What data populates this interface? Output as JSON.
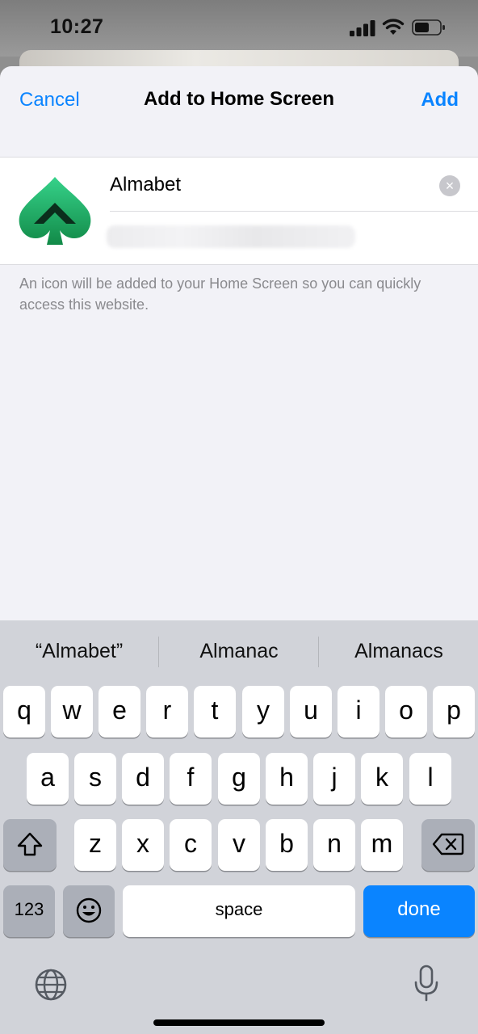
{
  "status_bar": {
    "time": "10:27"
  },
  "sheet": {
    "nav": {
      "cancel": "Cancel",
      "title": "Add to Home Screen",
      "add": "Add"
    },
    "app_name_value": "Almabet",
    "clear_icon": "clear-icon",
    "caption": "An icon will be added to your Home Screen so you can quickly access this website."
  },
  "keyboard": {
    "suggestions": [
      "“Almabet”",
      "Almanac",
      "Almanacs"
    ],
    "row1": [
      "q",
      "w",
      "e",
      "r",
      "t",
      "y",
      "u",
      "i",
      "o",
      "p"
    ],
    "row2": [
      "a",
      "s",
      "d",
      "f",
      "g",
      "h",
      "j",
      "k",
      "l"
    ],
    "row3": [
      "z",
      "x",
      "c",
      "v",
      "b",
      "n",
      "m"
    ],
    "numbers_label": "123",
    "space_label": "space",
    "done_label": "done",
    "icons": {
      "shift": "shift-icon",
      "delete": "delete-icon",
      "emoji": "emoji-icon",
      "globe": "globe-icon",
      "mic": "microphone-icon"
    }
  },
  "colors": {
    "accent": "#0a84ff",
    "background": "#f2f2f7",
    "keyboard": "#d1d3d9",
    "brand_green": "#1fb568"
  }
}
